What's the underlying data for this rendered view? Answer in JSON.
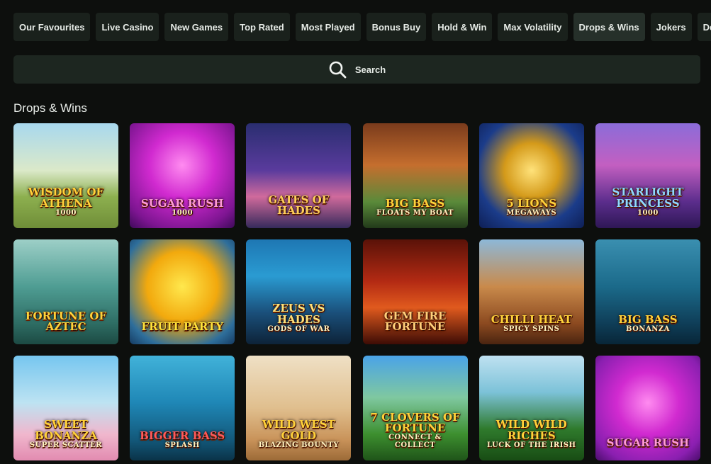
{
  "tabs": [
    {
      "label": "Our Favourites",
      "active": false
    },
    {
      "label": "Live Casino",
      "active": false
    },
    {
      "label": "New Games",
      "active": false
    },
    {
      "label": "Top Rated",
      "active": false
    },
    {
      "label": "Most Played",
      "active": false
    },
    {
      "label": "Bonus Buy",
      "active": false
    },
    {
      "label": "Hold & Win",
      "active": false
    },
    {
      "label": "Max Volatility",
      "active": false
    },
    {
      "label": "Drops & Wins",
      "active": true
    },
    {
      "label": "Jokers",
      "active": false
    },
    {
      "label": "Deep B",
      "active": false
    }
  ],
  "search": {
    "label": "Search",
    "icon": "search-icon"
  },
  "section": {
    "title": "Drops & Wins"
  },
  "games": [
    {
      "title": "Wisdom of Athena",
      "sub": "1000",
      "color": "#ffd23a"
    },
    {
      "title": "Sugar Rush",
      "sub": "1000",
      "color": "#ff9ad8"
    },
    {
      "title": "Gates of Hades",
      "sub": "",
      "color": "#ffcf5a"
    },
    {
      "title": "Big Bass",
      "sub": "Floats My Boat",
      "color": "#ffd23a"
    },
    {
      "title": "5 Lions",
      "sub": "Megaways",
      "color": "#ffd23a"
    },
    {
      "title": "Starlight Princess",
      "sub": "1000",
      "color": "#8fd8ff"
    },
    {
      "title": "Fortune of Aztec",
      "sub": "",
      "color": "#ffd23a"
    },
    {
      "title": "Fruit Party",
      "sub": "",
      "color": "#ffe23a"
    },
    {
      "title": "Zeus vs Hades",
      "sub": "Gods of War",
      "color": "#ffe27a"
    },
    {
      "title": "Gem Fire Fortune",
      "sub": "",
      "color": "#ffcf7a"
    },
    {
      "title": "Chilli Heat",
      "sub": "Spicy Spins",
      "color": "#ffd23a"
    },
    {
      "title": "Big Bass",
      "sub": "Bonanza",
      "color": "#ffd23a"
    },
    {
      "title": "Sweet Bonanza",
      "sub": "Super Scatter",
      "color": "#ffd23a"
    },
    {
      "title": "Bigger Bass",
      "sub": "Splash",
      "color": "#ff5a5a"
    },
    {
      "title": "Wild West Gold",
      "sub": "Blazing Bounty",
      "color": "#ffd23a"
    },
    {
      "title": "7 Clovers of Fortune",
      "sub": "Connect & Collect",
      "color": "#ffd23a"
    },
    {
      "title": "Wild Wild Riches",
      "sub": "Luck of the Irish",
      "color": "#ffd23a"
    },
    {
      "title": "Sugar Rush",
      "sub": "",
      "color": "#ff9ad8"
    }
  ]
}
